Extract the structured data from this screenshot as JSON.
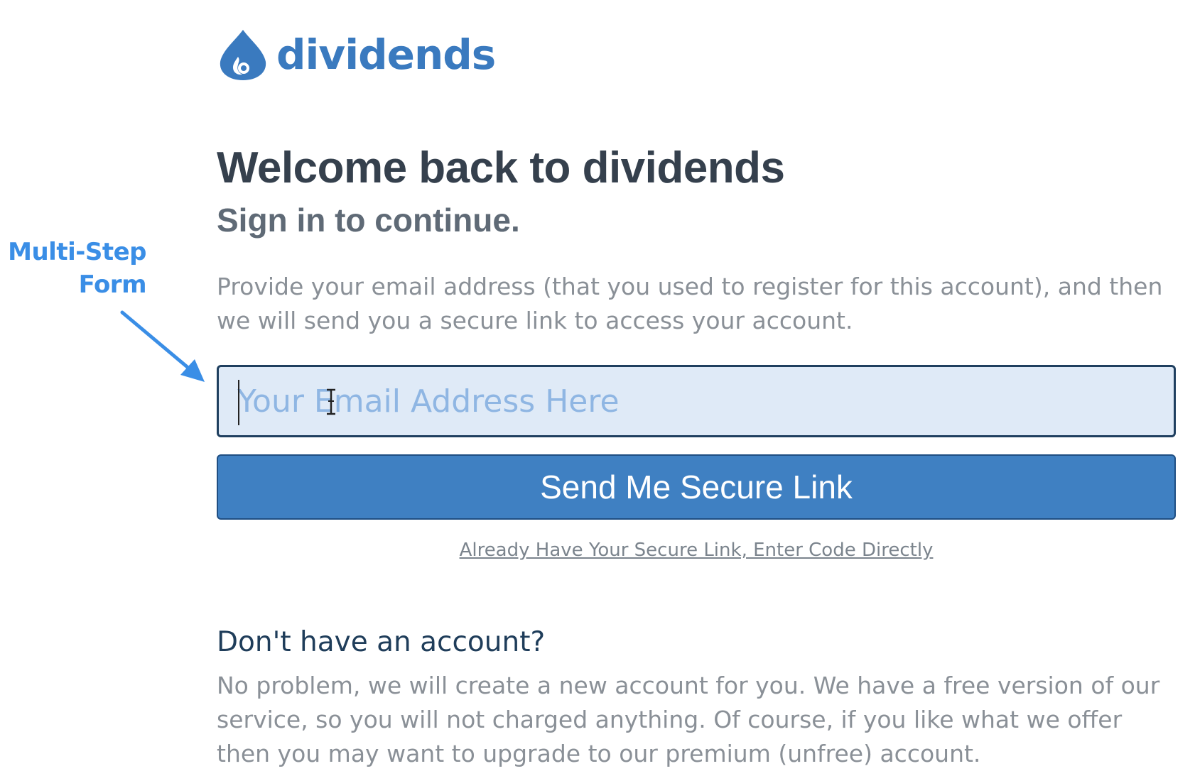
{
  "annotation": {
    "line1": "Multi-Step",
    "line2": "Form",
    "color": "#3a8ee6"
  },
  "brand": {
    "logo_icon": "water-drop-icon",
    "name": "dividends",
    "color": "#3a7abf"
  },
  "header": {
    "title": "Welcome back to dividends",
    "subtitle": "Sign in to continue."
  },
  "signin": {
    "description": "Provide your email address (that you used to register for this account), and then we will send you a secure link to access your account.",
    "email_placeholder": "Your Email Address Here",
    "email_value": "",
    "send_button_label": "Send Me Secure Link",
    "code_link_label": "Already Have Your Secure Link, Enter Code Directly",
    "button_color": "#3f80c2"
  },
  "signup": {
    "heading": "Don't have an account?",
    "body": "No problem, we will create a new account for you. We have a free version of our service, so you will not charged anything. Of course, if you like what we offer then you may want to upgrade to our premium (unfree) account."
  }
}
